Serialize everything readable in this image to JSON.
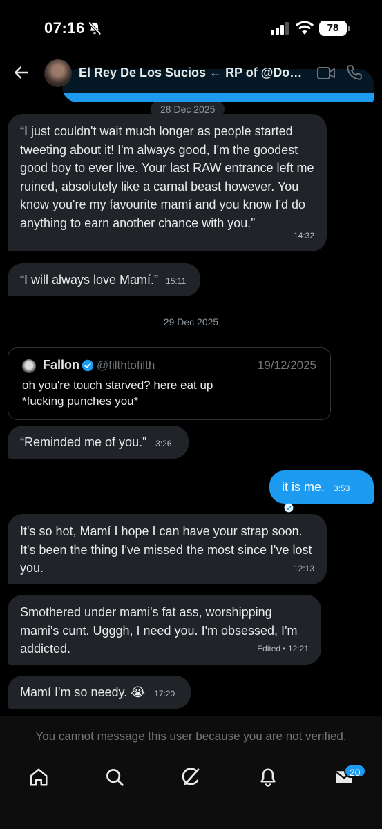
{
  "status_bar": {
    "time": "07:16",
    "battery": "78"
  },
  "header": {
    "title": "El Rey De Los Sucios ← RP of @Dom..."
  },
  "messages": {
    "date1": "28 Dec 2025",
    "m1_text": "“I just couldn't wait much longer as people started tweeting about it! I'm always good, I'm the goodest good boy to ever live. Your last RAW entrance left me ruined, absolutely like a carnal beast however. You know you're my favourite mamí and you know I'd do anything to earn another chance with you.”",
    "m1_time": "14:32",
    "m2_text": "“I will always love Mamí.”",
    "m2_time": "15:11",
    "date2": "29 Dec 2025",
    "quote": {
      "name": "Fallon",
      "handle": "@filthtofilth",
      "date": "19/12/2025",
      "text": "oh you're touch starved? here eat up\n*fucking punches you*"
    },
    "m3_text": "“Reminded me of you.”",
    "m3_time": "3:26",
    "m4_text": "it is me.",
    "m4_time": "3:53",
    "m5_text": "It's so hot, Mamí I hope I can have your strap soon. It's been the thing I've missed the most since I've lost you.",
    "m5_time": "12:13",
    "m6_text": "Smothered under mami's fat ass, worshipping mami's cunt. Ugggh, I need you. I'm obsessed, I'm addicted.",
    "m6_time": "Edited • 12:21",
    "m7_text": "Mamí I'm so needy. 😭",
    "m7_time": "17:20"
  },
  "footer": {
    "notice": "You cannot message this user because you are not verified.",
    "messages_badge": "20"
  },
  "colors": {
    "accent": "#1d9bf0",
    "bubble": "#202327",
    "background": "#000000"
  }
}
